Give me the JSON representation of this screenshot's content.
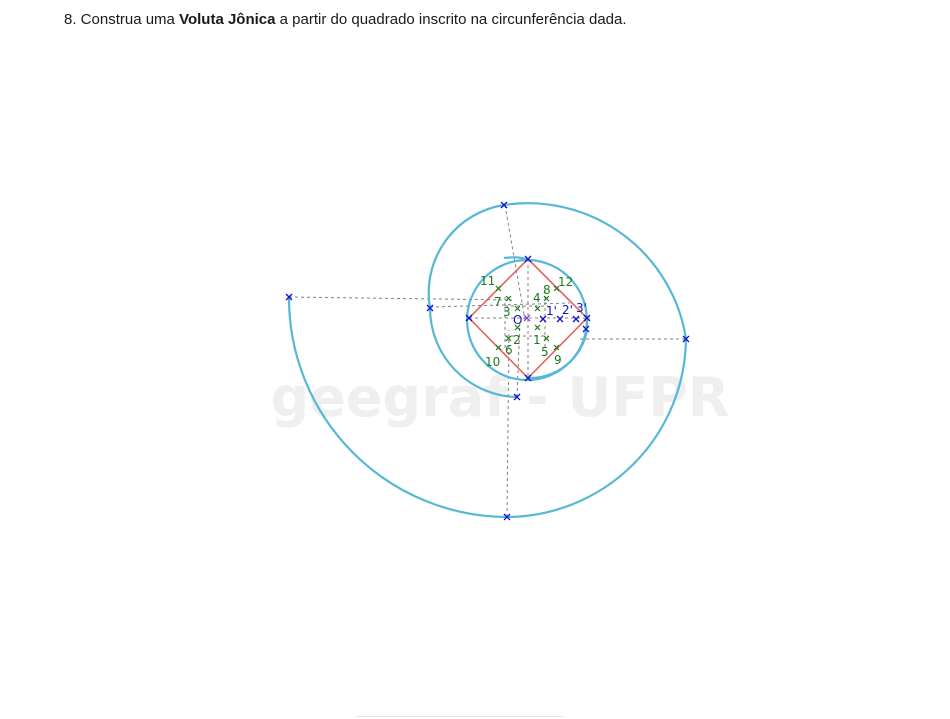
{
  "question": {
    "prefix": "8. Construa uma ",
    "bold": "Voluta Jônica",
    "suffix": " a partir do quadrado inscrito na circunferência dada."
  },
  "watermark": "geegraf - UFPR",
  "center_label": "O",
  "green_labels": [
    "1",
    "2",
    "3",
    "4",
    "5",
    "6",
    "7",
    "8",
    "9",
    "10",
    "11",
    "12"
  ],
  "blue_labels": [
    "1'",
    "2'",
    "3'"
  ],
  "colors": {
    "spiral": "#56b7d6",
    "square": "#e8605f",
    "construction": "#808080",
    "point_blue": "#1010d0",
    "point_green": "#1f7a1f",
    "watermark": "#efefef"
  }
}
